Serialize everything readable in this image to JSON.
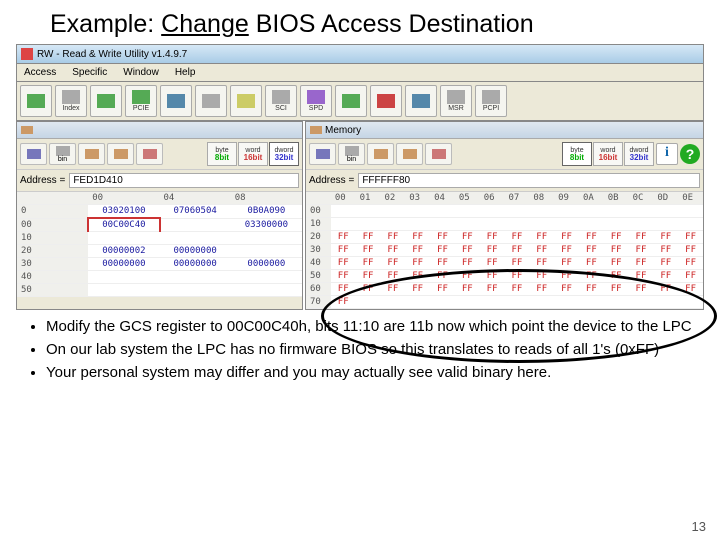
{
  "slide": {
    "title_prefix": "Example: ",
    "title_underlined": "Change",
    "title_suffix": " BIOS Access Destination",
    "page_number": "13"
  },
  "app": {
    "window_title": "RW - Read & Write Utility v1.4.9.7",
    "menu": [
      "Access",
      "Specific",
      "Window",
      "Help"
    ],
    "toolbar": [
      "",
      "Index",
      "",
      "PCIE",
      "",
      "",
      "",
      "SCI",
      "SPD",
      "",
      "",
      "",
      "MSR",
      "PCPI"
    ]
  },
  "panel_left": {
    "header_title": "",
    "width_btns": [
      {
        "top": "byte",
        "bot": "8bit",
        "cls": "b8"
      },
      {
        "top": "word",
        "bot": "16bit",
        "cls": "b16"
      },
      {
        "top": "dword",
        "bot": "32bit",
        "cls": "b32"
      }
    ],
    "address": "FED1D410",
    "cols": [
      "00",
      "04",
      "08"
    ],
    "rows": [
      {
        "off": "0",
        "vals": [
          "03020100",
          "07060504",
          "0B0A090"
        ]
      },
      {
        "off": "00",
        "vals": [
          "00C00C40",
          "",
          "03300000"
        ]
      },
      {
        "off": "10",
        "vals": [
          "",
          "",
          ""
        ]
      },
      {
        "off": "20",
        "vals": [
          "00000002",
          "00000000",
          ""
        ]
      },
      {
        "off": "30",
        "vals": [
          "00000000",
          "00000000",
          "0000000"
        ]
      },
      {
        "off": "40",
        "vals": [
          "",
          "",
          ""
        ]
      },
      {
        "off": "50",
        "vals": [
          "",
          "",
          ""
        ]
      }
    ]
  },
  "panel_right": {
    "header_title": "Memory",
    "width_btns": [
      {
        "top": "byte",
        "bot": "8bit",
        "cls": "b8"
      },
      {
        "top": "word",
        "bot": "16bit",
        "cls": "b16"
      },
      {
        "top": "dword",
        "bot": "32bit",
        "cls": "b32"
      }
    ],
    "address": "FFFFFF80",
    "cols": [
      "00",
      "01",
      "02",
      "03",
      "04",
      "05",
      "06",
      "07",
      "08",
      "09",
      "0A",
      "0B",
      "0C",
      "0D",
      "0E"
    ],
    "rows": [
      {
        "off": "00",
        "vals": []
      },
      {
        "off": "10",
        "vals": []
      },
      {
        "off": "20",
        "vals": [
          "FF",
          "FF",
          "FF",
          "FF",
          "FF",
          "FF",
          "FF",
          "FF",
          "FF",
          "FF",
          "FF",
          "FF",
          "FF",
          "FF",
          "FF"
        ]
      },
      {
        "off": "30",
        "vals": [
          "FF",
          "FF",
          "FF",
          "FF",
          "FF",
          "FF",
          "FF",
          "FF",
          "FF",
          "FF",
          "FF",
          "FF",
          "FF",
          "FF",
          "FF"
        ]
      },
      {
        "off": "40",
        "vals": [
          "FF",
          "FF",
          "FF",
          "FF",
          "FF",
          "FF",
          "FF",
          "FF",
          "FF",
          "FF",
          "FF",
          "FF",
          "FF",
          "FF",
          "FF"
        ]
      },
      {
        "off": "50",
        "vals": [
          "FF",
          "FF",
          "FF",
          "FF",
          "FF",
          "FF",
          "FF",
          "FF",
          "FF",
          "FF",
          "FF",
          "FF",
          "FF",
          "FF",
          "FF"
        ]
      },
      {
        "off": "60",
        "vals": [
          "FF",
          "FF",
          "FF",
          "FF",
          "FF",
          "FF",
          "FF",
          "FF",
          "FF",
          "FF",
          "FF",
          "FF",
          "FF",
          "FF",
          "FF"
        ]
      },
      {
        "off": "70",
        "vals": [
          "FF",
          "",
          "",
          "",
          "",
          "",
          "",
          "",
          "",
          "",
          "",
          "",
          "",
          "",
          ""
        ]
      }
    ]
  },
  "bullets": [
    "Modify the GCS register to 00C00C40h, bits 11:10 are 11b now which point the device to the LPC",
    "On our lab system the LPC has no firmware BIOS so this translates to reads of all 1's (0xFF)",
    "Your personal system may differ and you may actually see valid binary here."
  ]
}
